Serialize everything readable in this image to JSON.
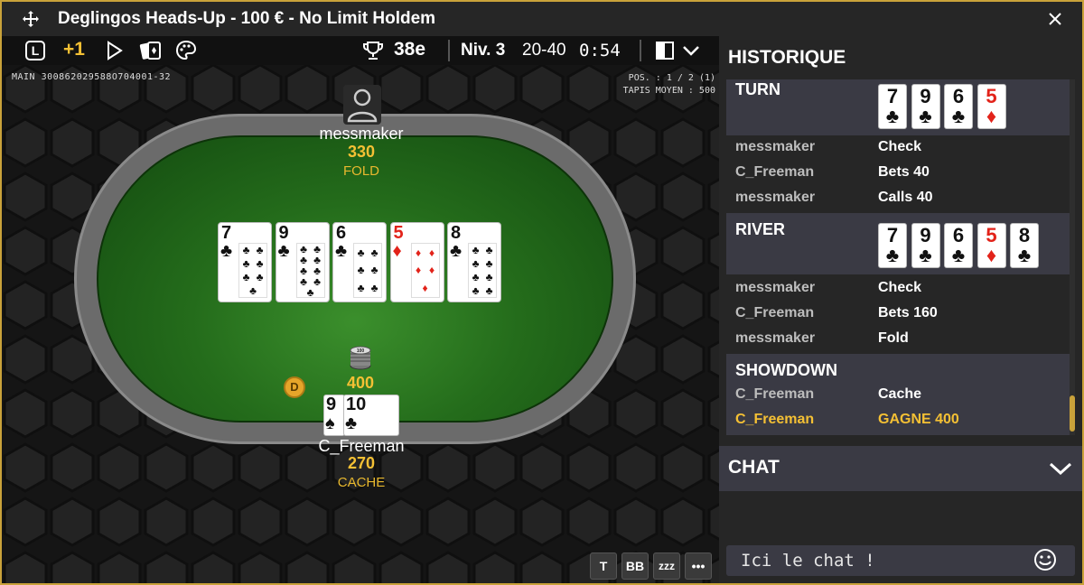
{
  "window": {
    "title": "Deglingos Heads-Up - 100 € - No Limit Holdem"
  },
  "toolbar": {
    "l_label": "L",
    "plus_label": "+1",
    "rank": "38e",
    "level": "Niv. 3",
    "blinds": "20-40",
    "timer": "0:54"
  },
  "hand": {
    "id": "MAIN 300862029588O704001-32",
    "position": "POS. : 1 / 2 (1)",
    "avg_stack": "TAPIS MOYEN : 500"
  },
  "players": {
    "top": {
      "name": "messmaker",
      "stack": "330",
      "action": "FOLD"
    },
    "bottom": {
      "name": "C_Freeman",
      "stack": "270",
      "action": "CACHE"
    }
  },
  "board": [
    {
      "rank": "7",
      "suit": "♣",
      "color": "black"
    },
    {
      "rank": "9",
      "suit": "♣",
      "color": "black"
    },
    {
      "rank": "6",
      "suit": "♣",
      "color": "black"
    },
    {
      "rank": "5",
      "suit": "♦",
      "color": "red"
    },
    {
      "rank": "8",
      "suit": "♣",
      "color": "black"
    }
  ],
  "hole_cards": [
    {
      "rank": "9",
      "suit": "♠",
      "color": "black"
    },
    {
      "rank": "10",
      "suit": "♣",
      "color": "black"
    }
  ],
  "pot": "400",
  "chip_label": "100",
  "dealer_label": "D",
  "bottom_buttons": [
    "T",
    "BB",
    "zzz",
    "•••"
  ],
  "history": {
    "title": "HISTORIQUE",
    "turn_title": "TURN",
    "turn_cards": [
      {
        "rank": "7",
        "suit": "♣",
        "color": "black"
      },
      {
        "rank": "9",
        "suit": "♣",
        "color": "black"
      },
      {
        "rank": "6",
        "suit": "♣",
        "color": "black"
      },
      {
        "rank": "5",
        "suit": "♦",
        "color": "red"
      }
    ],
    "turn_actions": [
      {
        "player": "messmaker",
        "action": "Check"
      },
      {
        "player": "C_Freeman",
        "action": "Bets 40"
      },
      {
        "player": "messmaker",
        "action": "Calls 40"
      }
    ],
    "river_title": "RIVER",
    "river_cards": [
      {
        "rank": "7",
        "suit": "♣",
        "color": "black"
      },
      {
        "rank": "9",
        "suit": "♣",
        "color": "black"
      },
      {
        "rank": "6",
        "suit": "♣",
        "color": "black"
      },
      {
        "rank": "5",
        "suit": "♦",
        "color": "red"
      },
      {
        "rank": "8",
        "suit": "♣",
        "color": "black"
      }
    ],
    "river_actions": [
      {
        "player": "messmaker",
        "action": "Check"
      },
      {
        "player": "C_Freeman",
        "action": "Bets 160"
      },
      {
        "player": "messmaker",
        "action": "Fold"
      }
    ],
    "showdown_title": "SHOWDOWN",
    "showdown_actions": [
      {
        "player": "C_Freeman",
        "action": "Cache"
      },
      {
        "player": "C_Freeman",
        "action": "GAGNE 400"
      }
    ]
  },
  "chat": {
    "title": "CHAT",
    "placeholder": "Ici le chat !"
  },
  "colors": {
    "accent_gold": "#c9a23a",
    "stack_gold": "#f4c034",
    "felt_green": "#246c1b",
    "panel_bg": "#262626",
    "section_bg": "#3a3a44"
  }
}
